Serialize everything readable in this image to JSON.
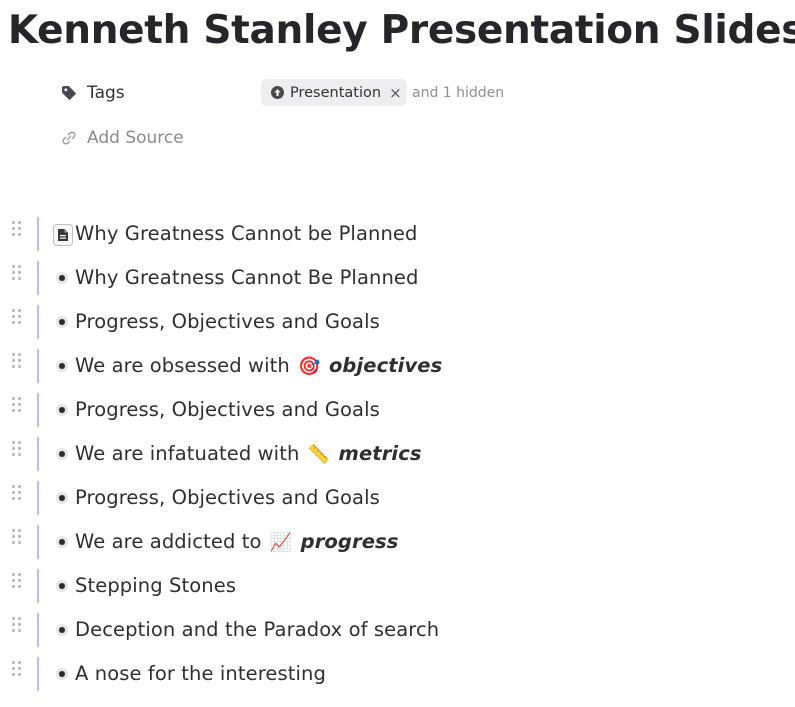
{
  "page": {
    "title": "Kenneth Stanley Presentation Slides"
  },
  "properties": {
    "tags_label": "Tags",
    "tag_pill": "Presentation",
    "tag_remove": "×",
    "hidden_note": "and 1 hidden",
    "source_label": "Add Source"
  },
  "blocks": [
    {
      "text": "Why Greatness Cannot be Planned",
      "kind": "document"
    },
    {
      "text": "Why Greatness Cannot Be Planned",
      "kind": "bullet"
    },
    {
      "text": "Progress, Objectives and Goals",
      "kind": "bullet"
    },
    {
      "text": "We are obsessed with",
      "emoji": "🎯",
      "emph": "objectives",
      "kind": "bullet"
    },
    {
      "text": "Progress, Objectives and Goals",
      "kind": "bullet"
    },
    {
      "text": "We are infatuated with",
      "emoji": "📏",
      "emph": "metrics",
      "kind": "bullet"
    },
    {
      "text": "Progress, Objectives and Goals",
      "kind": "bullet"
    },
    {
      "text": "We are addicted to",
      "emoji": "📈",
      "emph": "progress",
      "kind": "bullet"
    },
    {
      "text": "Stepping Stones",
      "kind": "bullet"
    },
    {
      "text": "Deception and the Paradox of search",
      "kind": "bullet"
    },
    {
      "text": "A nose for the interesting",
      "kind": "bullet"
    }
  ],
  "icons": {
    "tags": "tag-icon",
    "source": "link-icon",
    "tag_pill": "arrow-up-circle-icon",
    "doc": "document-icon",
    "handle": "drag-handle-icon"
  }
}
